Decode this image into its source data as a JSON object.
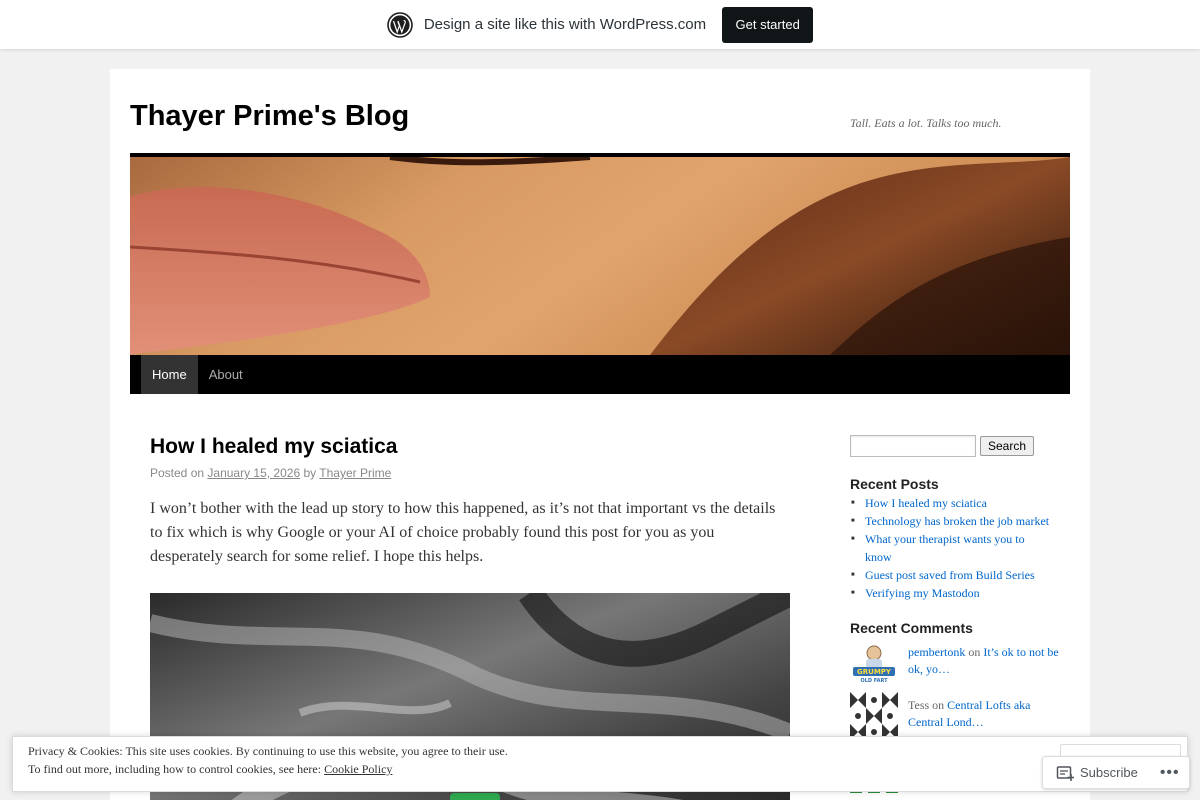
{
  "wpbar": {
    "text": "Design a site like this with WordPress.com",
    "cta": "Get started"
  },
  "site": {
    "title": "Thayer Prime's Blog",
    "description": "Tall. Eats a lot. Talks too much."
  },
  "nav": {
    "items": [
      {
        "label": "Home",
        "current": true
      },
      {
        "label": "About",
        "current": false
      }
    ]
  },
  "post": {
    "title": "How I healed my sciatica",
    "meta_posted": "Posted on",
    "meta_date": "January 15, 2026",
    "meta_by": "by",
    "meta_author": "Thayer Prime",
    "body": "I won’t bother with the lead up story to how this happened, as it’s not that important vs the details to fix which is why Google or your AI of choice probably found this post for you as you desperately search for some relief. I hope this helps."
  },
  "sidebar": {
    "search_button": "Search",
    "recent_posts_title": "Recent Posts",
    "recent_posts": [
      "How I healed my sciatica",
      "Technology has broken the job market",
      "What your therapist wants you to know",
      "Guest post saved from Build Series",
      "Verifying my Mastodon"
    ],
    "recent_comments_title": "Recent Comments",
    "comments": [
      {
        "author": "pembertonk",
        "on": "on",
        "post": "It’s ok to not be ok, yo…",
        "author_link": true
      },
      {
        "author": "Tess",
        "on": "on",
        "post": "Central Lofts aka Central Lond…",
        "author_link": false
      }
    ]
  },
  "cookie": {
    "line1": "Privacy & Cookies: This site uses cookies. By continuing to use this website, you agree to their use.",
    "line2_prefix": "To find out more, including how to control cookies, see here:",
    "line2_link": "Cookie Policy"
  },
  "subscribe": {
    "label": "Subscribe",
    "more": "•••"
  },
  "colors": {
    "link": "#0066cc",
    "nav_bg": "#000000",
    "cta_bg": "#101517"
  }
}
